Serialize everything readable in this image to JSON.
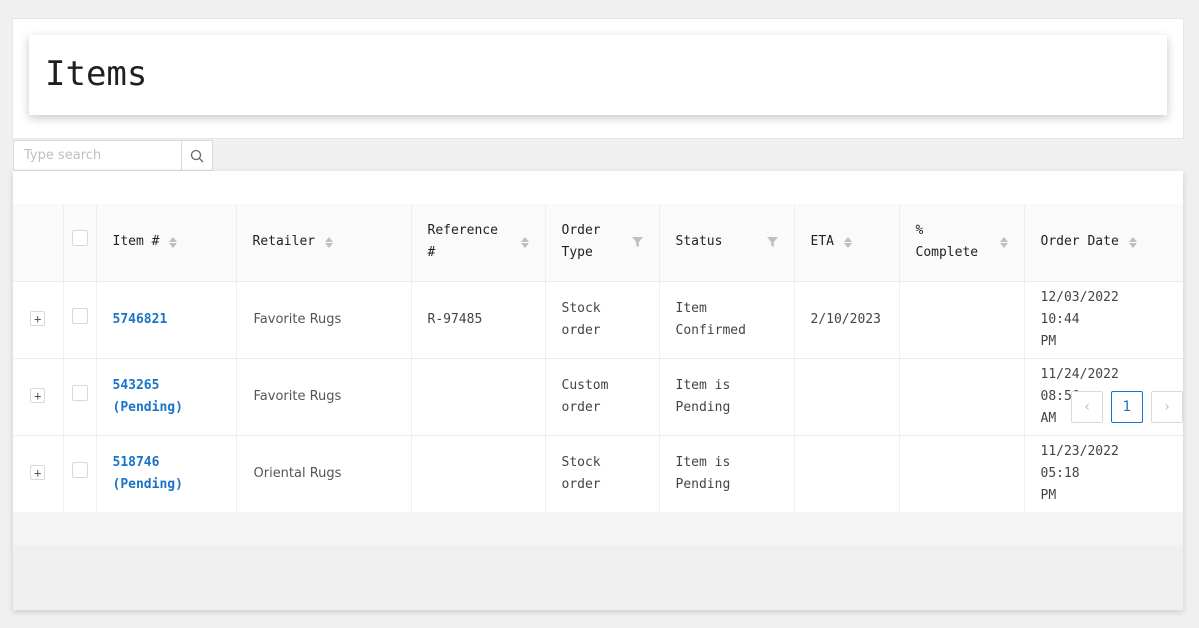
{
  "header": {
    "title": "Items"
  },
  "search": {
    "placeholder": "Type search"
  },
  "table": {
    "columns": {
      "item": "Item #",
      "retailer": "Retailer",
      "reference": "Reference #",
      "order_type": "Order Type",
      "status": "Status",
      "eta": "ETA",
      "complete": "% Complete",
      "order_date": "Order Date"
    },
    "rows": [
      {
        "item": "5746821",
        "retailer": "Favorite Rugs",
        "reference": "R-97485",
        "order_type": "Stock order",
        "status": "Item Confirmed",
        "eta": "2/10/2023",
        "complete": "",
        "order_date": "12/03/2022 10:44 PM"
      },
      {
        "item": "543265 (Pending)",
        "retailer": "Favorite Rugs",
        "reference": "",
        "order_type": "Custom order",
        "status": "Item is Pending",
        "eta": "",
        "complete": "",
        "order_date": "11/24/2022 08:56 AM"
      },
      {
        "item": "518746 (Pending)",
        "retailer": "Oriental Rugs",
        "reference": "",
        "order_type": "Stock order",
        "status": "Item is Pending",
        "eta": "",
        "complete": "",
        "order_date": "11/23/2022 05:18 PM"
      }
    ]
  },
  "pagination": {
    "prev": "‹",
    "current": "1",
    "next": "›"
  },
  "colors": {
    "accent": "#1a73c8",
    "link": "#1a73c8"
  }
}
